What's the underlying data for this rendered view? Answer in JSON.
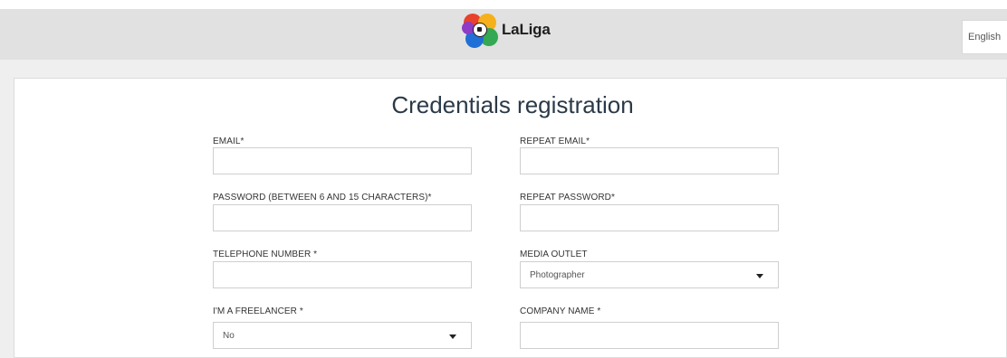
{
  "header": {
    "logo_text": "LaLiga",
    "language": {
      "selected": "English"
    }
  },
  "page": {
    "title": "Credentials registration"
  },
  "form": {
    "email": {
      "label": "EMAIL*",
      "value": ""
    },
    "repeat_email": {
      "label": "REPEAT EMAIL*",
      "value": ""
    },
    "password": {
      "label": "PASSWORD (BETWEEN 6 AND 15 CHARACTERS)*",
      "value": ""
    },
    "repeat_password": {
      "label": "REPEAT PASSWORD*",
      "value": ""
    },
    "telephone": {
      "label": "TELEPHONE NUMBER *",
      "value": ""
    },
    "media_outlet": {
      "label": "MEDIA OUTLET",
      "selected": "Photographer"
    },
    "freelancer": {
      "label": "I'M A FREELANCER *",
      "selected": "No"
    },
    "company_name": {
      "label": "COMPANY NAME *",
      "value": ""
    }
  },
  "colors": {
    "header_bg": "#e1e1e1",
    "page_bg": "#efefef",
    "title": "#2b3a48",
    "logo_petals": [
      "#e8412c",
      "#f6b01b",
      "#34a853",
      "#1f6fd6",
      "#8e3cc5"
    ]
  },
  "icons": {
    "logo": "laliga-logo-icon",
    "language_caret": "chevron-down-icon",
    "select_caret": "chevron-down-icon"
  }
}
